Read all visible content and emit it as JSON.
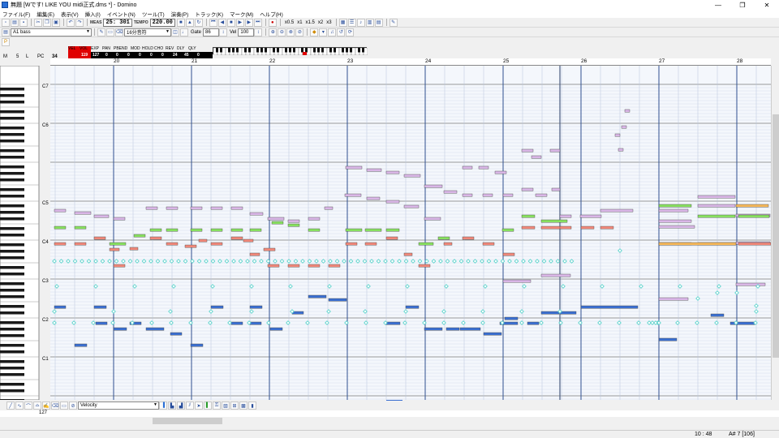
{
  "window": {
    "title": "無題 [Wです! LIKE YOU midi正式.dms *] - Domino",
    "controls": [
      "—",
      "❐",
      "✕"
    ]
  },
  "menu": [
    "ファイル(F)",
    "編集(E)",
    "表示(V)",
    "挿入(I)",
    "イベント(N)",
    "ツール(T)",
    "演奏(P)",
    "トラック(K)",
    "マーク(M)",
    "ヘルプ(H)"
  ],
  "toolbar1": {
    "meas_label": "MEAS",
    "meas_value": "25: 301",
    "tempo_label": "TEMPO",
    "tempo_value": "220.00",
    "zoom_buttons": [
      "x0.5",
      "x1",
      "x1.5",
      "x2",
      "x3"
    ]
  },
  "toolbar2": {
    "track_name": "A1 bass",
    "quantize": "16分音符",
    "gate_label": "Gate",
    "gate_value": "86",
    "vel_label": "Vel",
    "vel_value": "100"
  },
  "cc_strip": {
    "m_label": "M",
    "m_val": "5",
    "l_label": "L",
    "pc_label": "PC",
    "pc_val": "34",
    "labels": [
      "VEL",
      "VOL",
      "EXP",
      "PAN",
      "PBEND",
      "MOD",
      "HOLD",
      "CHO",
      "REV",
      "DLY",
      "QLY"
    ],
    "values": [
      "119",
      "127",
      "0",
      "0",
      "0",
      "0",
      "0",
      "0",
      "24",
      "45",
      "0"
    ]
  },
  "ruler": {
    "measures": [
      "20",
      "21",
      "22",
      "23",
      "24",
      "25",
      "26",
      "27",
      "28"
    ]
  },
  "octave_labels": [
    "C6",
    "C5",
    "C4",
    "C3",
    "C2",
    "C1",
    "C7"
  ],
  "bottom": {
    "controller": "Velocity",
    "vel_max": "127"
  },
  "status": {
    "time": "10 : 48",
    "note": "A# 7 [106]"
  },
  "colors": {
    "bass": "#3b6fd0",
    "chord": "#d9b6e6",
    "green": "#88e060",
    "red": "#f0887a",
    "cyan": "#4fd0c8",
    "orange": "#f6b85a"
  }
}
